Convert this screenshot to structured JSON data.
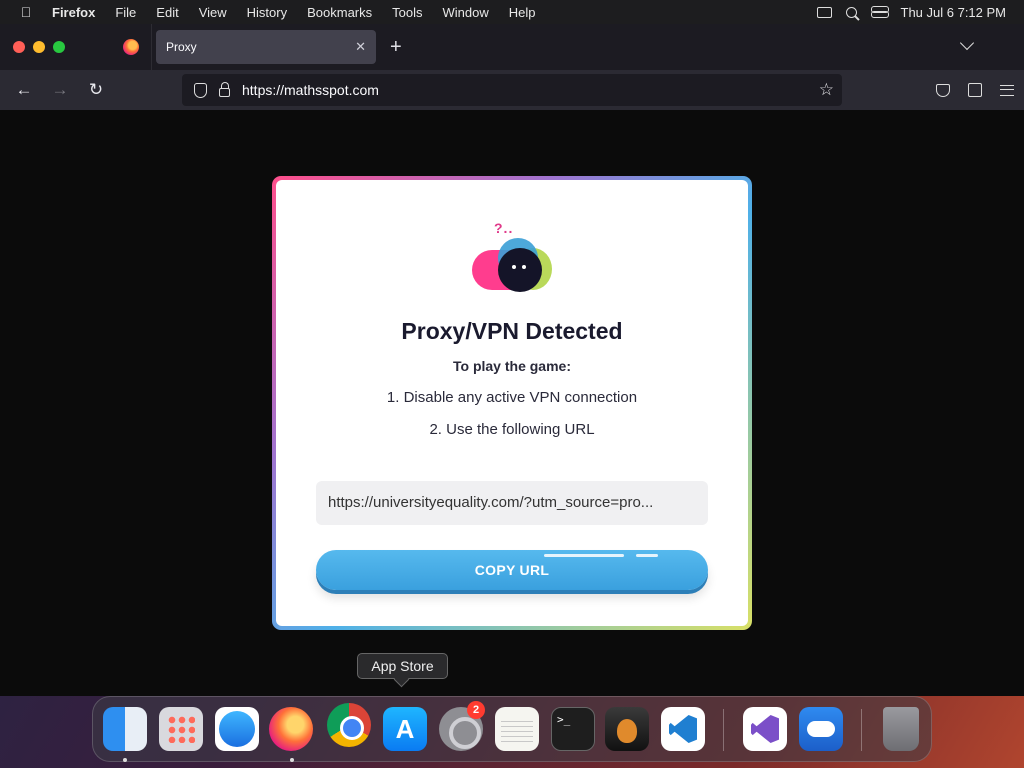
{
  "menubar": {
    "app_name": "Firefox",
    "menus": [
      "File",
      "Edit",
      "View",
      "History",
      "Bookmarks",
      "Tools",
      "Window",
      "Help"
    ],
    "clock": "Thu Jul 6  7:12 PM"
  },
  "browser": {
    "tab_title": "Proxy",
    "url": "https://mathsspot.com"
  },
  "page": {
    "heading": "Proxy/VPN Detected",
    "subheading": "To play the game:",
    "step1": "1. Disable any active VPN connection",
    "step2": "2. Use the following URL",
    "url_value": "https://universityequality.com/?utm_source=pro...",
    "copy_label": "COPY URL",
    "mascot_text": "?.."
  },
  "tooltip": {
    "text": "App Store"
  },
  "dock": {
    "settings_badge": "2",
    "terminal_prompt": ">_"
  },
  "colors": {
    "accent_button": "#3aa0de",
    "card_border_start": "#ff4f8b",
    "card_border_end": "#d9e066"
  }
}
